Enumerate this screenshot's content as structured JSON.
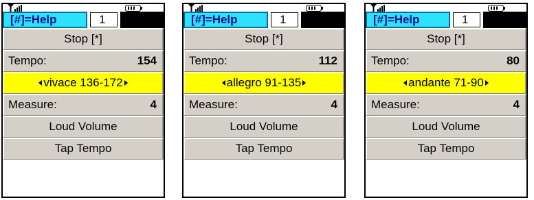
{
  "screens": [
    {
      "help_label": "[#]=Help",
      "page_number": "1",
      "stop_label": "Stop [*]",
      "tempo_label": "Tempo:",
      "tempo_value": "154",
      "tempo_range": "vivace 136-172",
      "measure_label": "Measure:",
      "measure_value": "4",
      "volume_label": "Loud Volume",
      "tap_label": "Tap Tempo"
    },
    {
      "help_label": "[#]=Help",
      "page_number": "1",
      "stop_label": "Stop [*]",
      "tempo_label": "Tempo:",
      "tempo_value": "112",
      "tempo_range": "allegro 91-135",
      "measure_label": "Measure:",
      "measure_value": "4",
      "volume_label": "Loud Volume",
      "tap_label": "Tap Tempo"
    },
    {
      "help_label": "[#]=Help",
      "page_number": "1",
      "stop_label": "Stop [*]",
      "tempo_label": "Tempo:",
      "tempo_value": "80",
      "tempo_range": "andante 71-90",
      "measure_label": "Measure:",
      "measure_value": "4",
      "volume_label": "Loud Volume",
      "tap_label": "Tap Tempo"
    }
  ],
  "icons": {
    "status_left": "signal-strength-icon",
    "status_right": "battery-icon",
    "range_left": "left-arrow-icon",
    "range_right": "right-arrow-icon"
  },
  "colors": {
    "help_background": "#2ee2ff",
    "help_text": "#0d0d8c",
    "selected_row": "#ffff00",
    "menu_row": "#d4d0c8"
  }
}
